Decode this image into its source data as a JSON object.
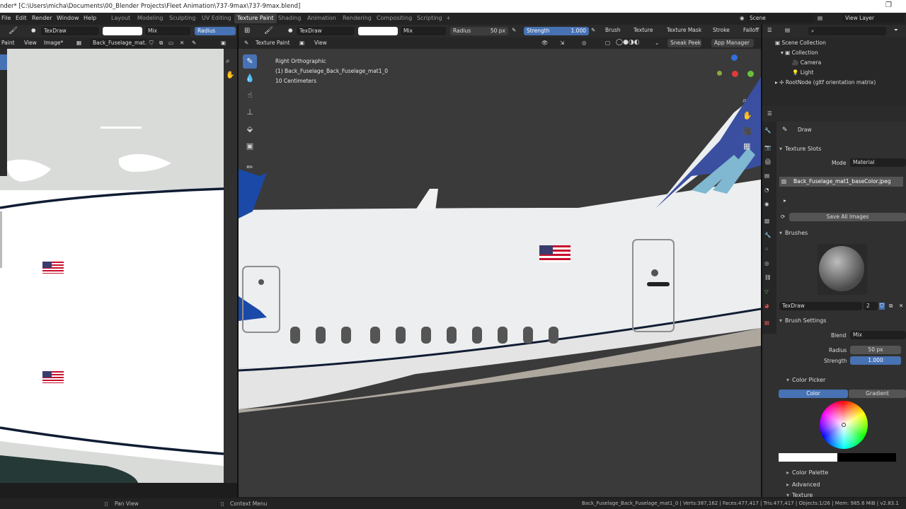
{
  "titlebar": {
    "title": "nder* [C:\\Users\\micha\\Documents\\00_Blender Projects\\Fleet Animation\\737-9max\\737-9max.blend]"
  },
  "menu": [
    "File",
    "Edit",
    "Render",
    "Window",
    "Help"
  ],
  "workspaces": [
    "Layout",
    "Modeling",
    "Sculpting",
    "UV Editing",
    "Texture Paint",
    "Shading",
    "Animation",
    "Rendering",
    "Compositing",
    "Scripting",
    "+"
  ],
  "topright": {
    "scene": "Scene",
    "view_layer": "View Layer"
  },
  "image_editor": {
    "brush_name": "TexDraw",
    "blend": "Mix",
    "radius_label": "Radius",
    "mode": "Paint",
    "view": "View",
    "image_menu": "Image*",
    "image_name": "Back_Fuselage_mat..."
  },
  "viewport": {
    "brush_name": "TexDraw",
    "blend": "Mix",
    "radius_label": "Radius",
    "radius_value": "50 px",
    "strength_label": "Strength",
    "strength_value": "1.000",
    "menus": [
      "Brush",
      "Texture",
      "Texture Mask",
      "Stroke",
      "Falloff"
    ],
    "mode": "Texture Paint",
    "view": "View",
    "sneak_peek": "Sneak Peek",
    "app_manager": "App Manager",
    "overlay": [
      "Right Orthographic",
      "(1) Back_Fuselage_Back_Fuselage_mat1_0",
      "10 Centimeters"
    ]
  },
  "outliner": {
    "root": "Scene Collection",
    "items": [
      "Collection",
      "Camera",
      "Light"
    ],
    "rootnode": "RootNode (gltf orientation matrix)"
  },
  "properties": {
    "tool": "Draw",
    "texture_slots": "Texture Slots",
    "mode_label": "Mode",
    "mode_value": "Material",
    "slot_name": "Back_Fuselage_mat1_baseColor.jpeg",
    "save_all": "Save All Images",
    "brushes": "Brushes",
    "brush_name": "TexDraw",
    "brush_users": "2",
    "brush_settings": "Brush Settings",
    "blend_label": "Blend",
    "blend_value": "Mix",
    "radius_label": "Radius",
    "radius_value": "50 px",
    "strength_label": "Strength",
    "strength_value": "1.000",
    "color_picker": "Color Picker",
    "color_tab": "Color",
    "gradient_tab": "Gradient",
    "color_palette": "Color Palette",
    "advanced": "Advanced",
    "texture": "Texture"
  },
  "statusbar": {
    "pan": "Pan View",
    "context": "Context Menu",
    "stats": "Back_Fuselage_Back_Fuselage_mat1_0 | Verts:387,162 | Faces:477,417 | Tris:477,417 | Objects:1/26 | Mem: 985.6 MiB | v2.83.1"
  },
  "colors": {
    "accent": "#4772b3",
    "header": "#2b2b2b",
    "panel": "#303030"
  }
}
